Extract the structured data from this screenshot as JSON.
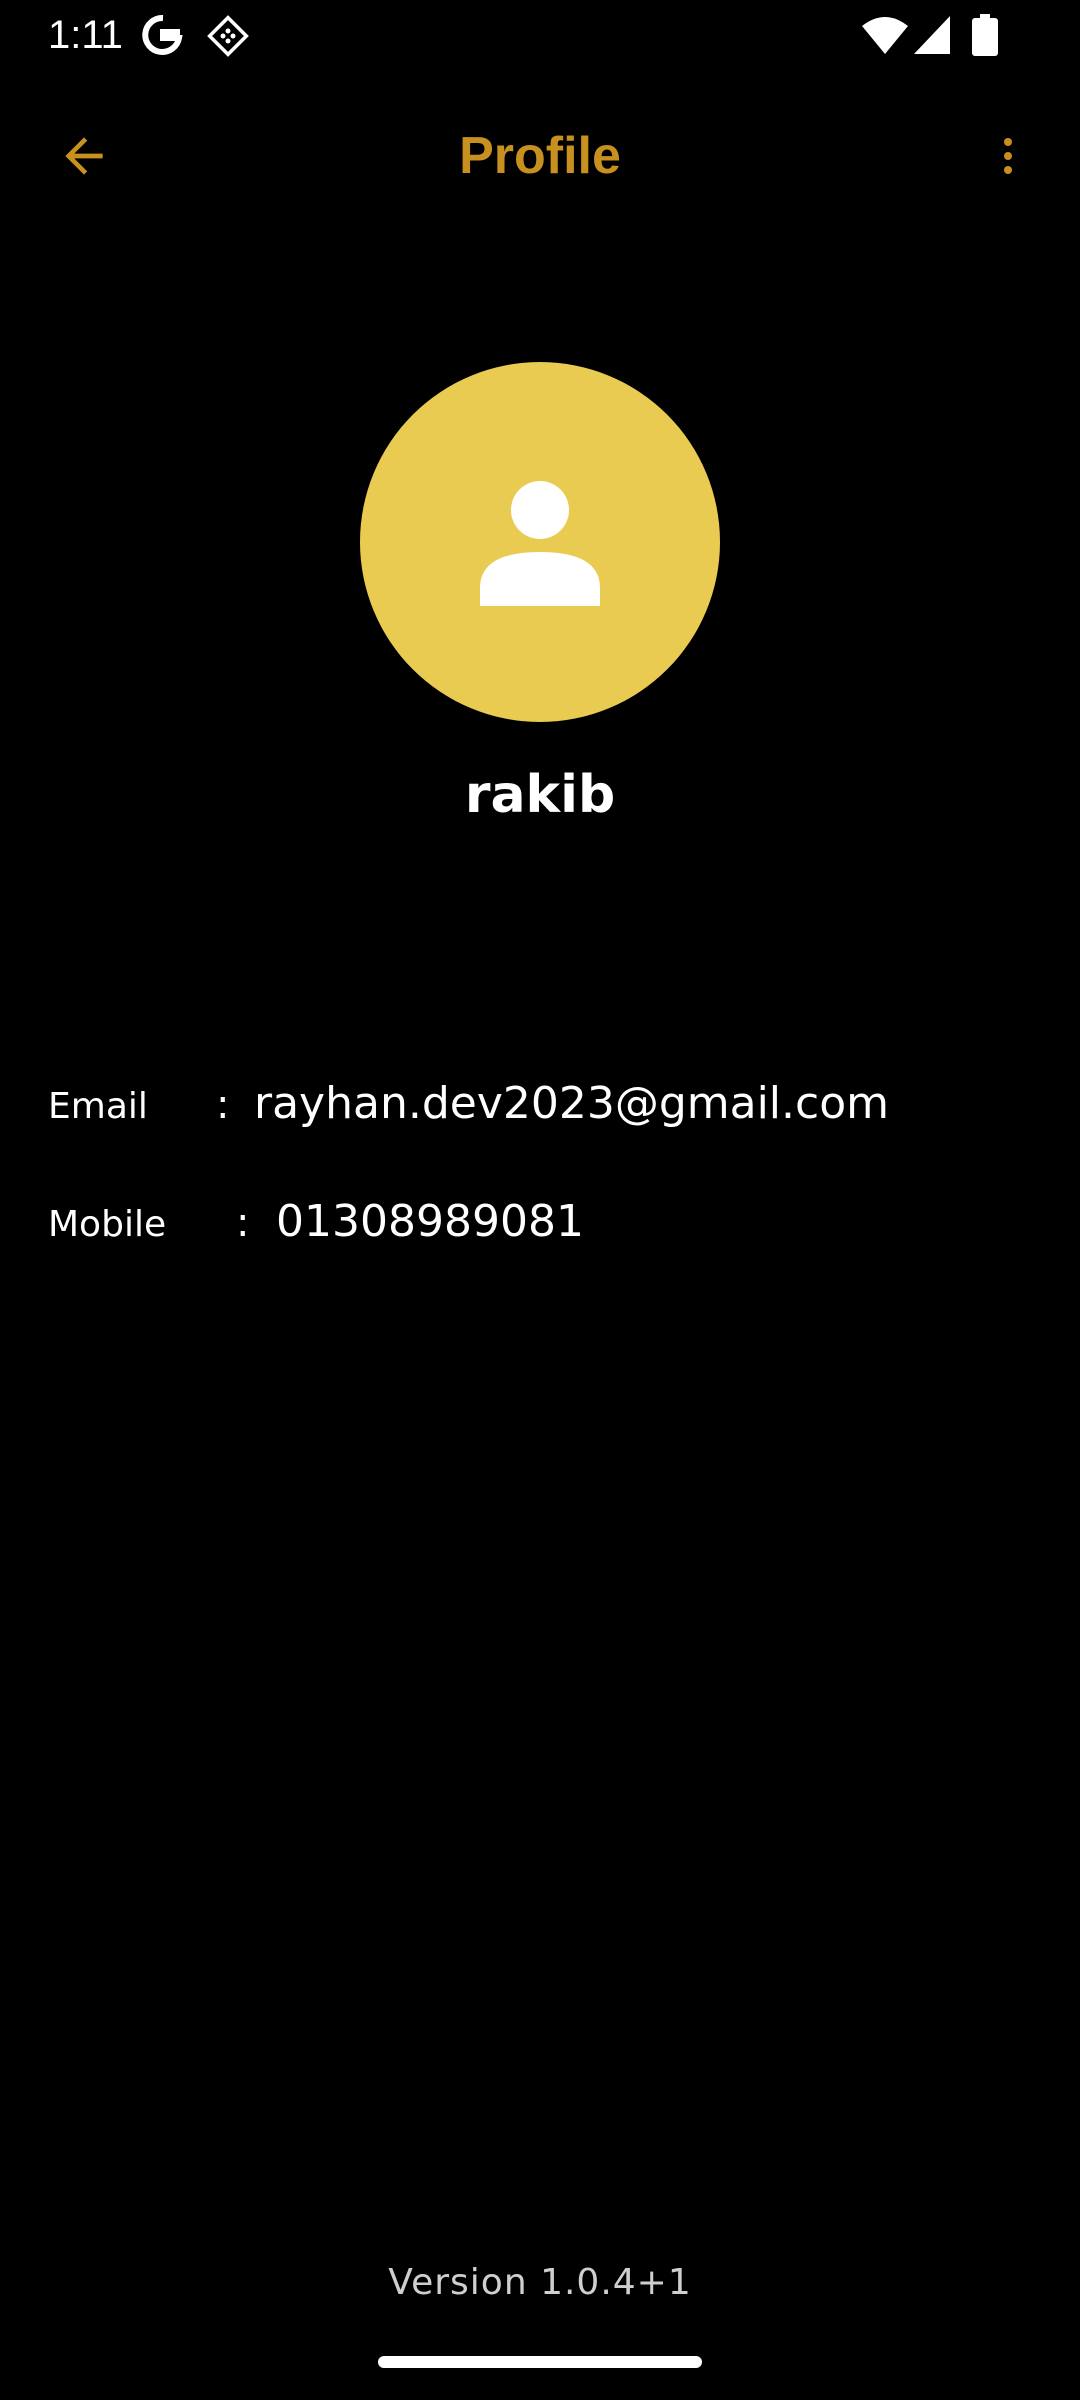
{
  "status_bar": {
    "time": "1:11"
  },
  "app_bar": {
    "title": "Profile"
  },
  "profile": {
    "name": "rakib"
  },
  "info": {
    "email_label": "Email",
    "email_value": "rayhan.dev2023@gmail.com",
    "mobile_label": "Mobile",
    "mobile_value": "01308989081",
    "separator": ":"
  },
  "footer": {
    "version": "Version 1.0.4+1"
  },
  "colors": {
    "accent": "#C8901E",
    "avatar_bg": "#E9CB51",
    "background": "#000000"
  },
  "icons": {
    "back": "arrow-left-icon",
    "more": "more-vert-icon",
    "avatar": "person-icon"
  }
}
